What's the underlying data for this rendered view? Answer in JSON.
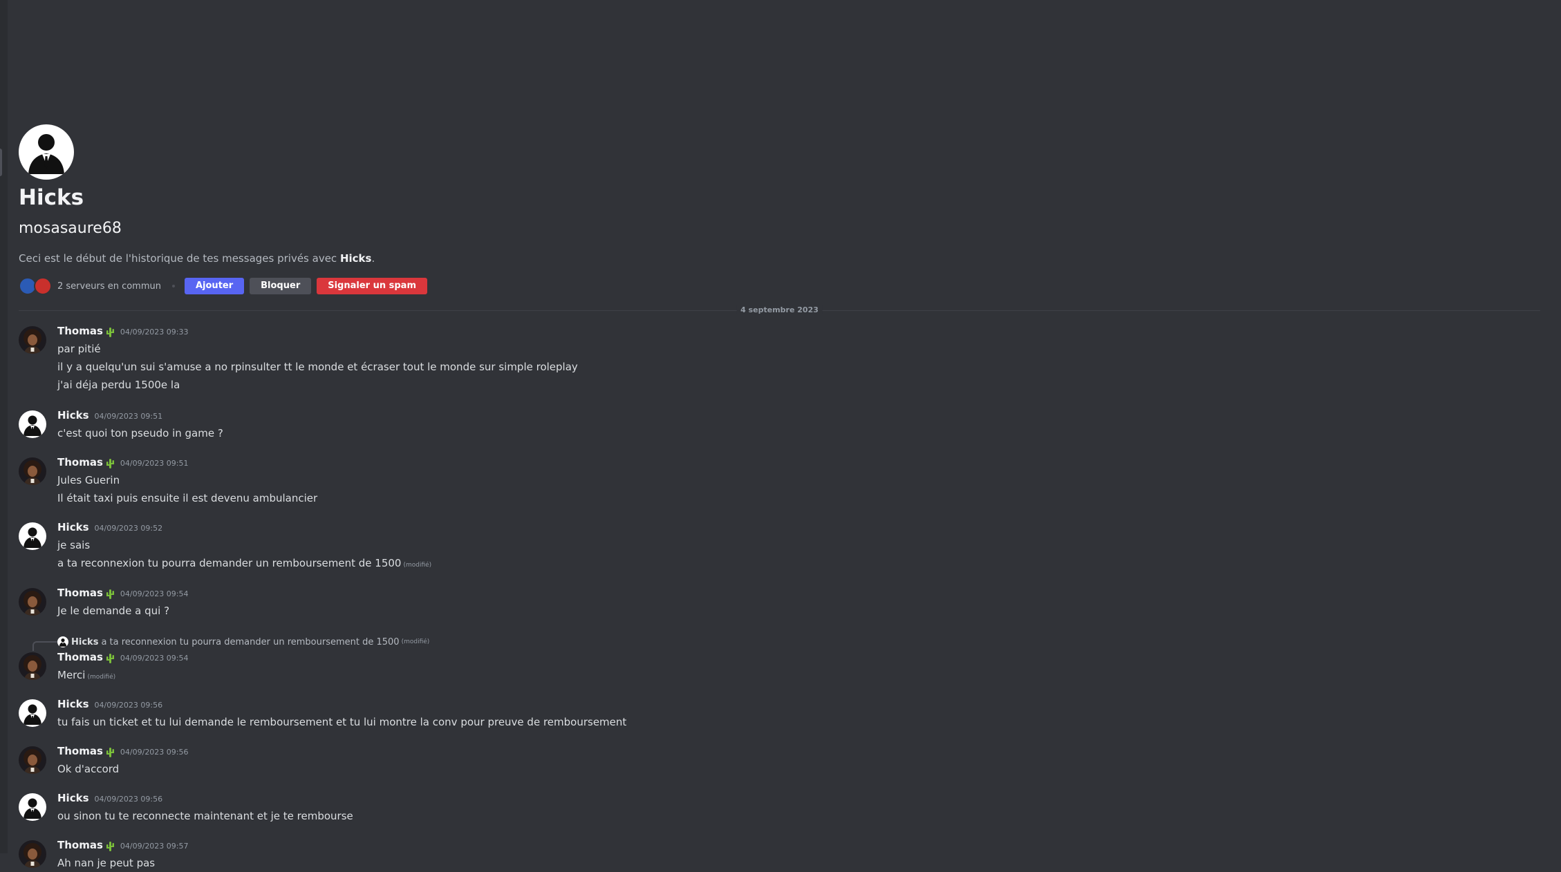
{
  "profile": {
    "name": "Hicks",
    "username": "mosasaure68",
    "welcome_prefix": "Ceci est le début de l'historique de tes messages privés avec ",
    "welcome_name": "Hicks",
    "welcome_suffix": ".",
    "mutual_servers": "2 serveurs en commun",
    "add_label": "Ajouter",
    "block_label": "Bloquer",
    "spam_label": "Signaler un spam"
  },
  "date_divider": "4 septembre 2023",
  "edited_label": "(modifié)",
  "messages": [
    {
      "author": "Thomas",
      "timestamp": "04/09/2023 09:33",
      "lines": [
        "par pitié",
        "il y a quelqu'un sui s'amuse a no rpinsulter tt le monde et écraser tout le monde sur simple roleplay",
        "j'ai déja perdu 1500e la"
      ]
    },
    {
      "author": "Hicks",
      "timestamp": "04/09/2023 09:51",
      "lines": [
        "c'est quoi ton pseudo in game ?"
      ]
    },
    {
      "author": "Thomas",
      "timestamp": "04/09/2023 09:51",
      "lines": [
        "Jules Guerin",
        "Il était taxi puis ensuite il est devenu ambulancier"
      ]
    },
    {
      "author": "Hicks",
      "timestamp": "04/09/2023 09:52",
      "lines": [
        "je sais",
        "a ta reconnexion tu pourra demander un remboursement de 1500"
      ]
    },
    {
      "author": "Thomas",
      "timestamp": "04/09/2023 09:54",
      "lines": [
        "Je le demande a qui ?"
      ]
    },
    {
      "author": "Thomas",
      "timestamp": "04/09/2023 09:54",
      "lines": [
        "Merci"
      ],
      "reply": {
        "author": "Hicks",
        "text": "a ta reconnexion tu pourra demander un remboursement de 1500"
      }
    },
    {
      "author": "Hicks",
      "timestamp": "04/09/2023 09:56",
      "lines": [
        "tu fais un ticket et tu lui demande le remboursement et tu lui montre la conv pour preuve de remboursement"
      ]
    },
    {
      "author": "Thomas",
      "timestamp": "04/09/2023 09:56",
      "lines": [
        "Ok d'accord"
      ]
    },
    {
      "author": "Hicks",
      "timestamp": "04/09/2023 09:56",
      "lines": [
        "ou sinon tu  te reconnecte maintenant et je te rembourse"
      ]
    },
    {
      "author": "Thomas",
      "timestamp": "04/09/2023 09:57",
      "lines": [
        "Ah nan je peut pas"
      ]
    }
  ]
}
